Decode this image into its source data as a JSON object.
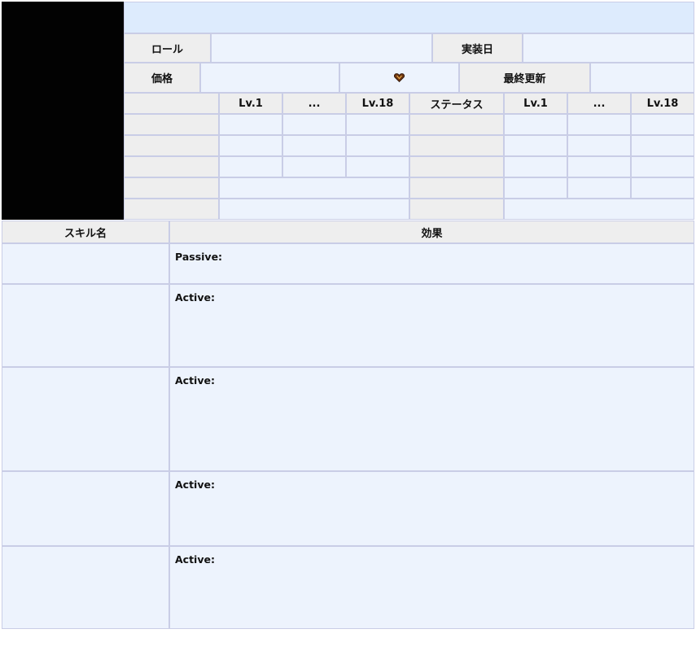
{
  "info": {
    "role_label": "ロール",
    "release_label": "実装日",
    "price_label": "価格",
    "updated_label": "最終更新",
    "currency_icon": "heart-gem-icon"
  },
  "stats": {
    "headers": [
      "Lv.1",
      "...",
      "Lv.18",
      "ステータス",
      "Lv.1",
      "...",
      "Lv.18"
    ]
  },
  "skills": {
    "name_header": "スキル名",
    "effect_header": "効果",
    "rows": [
      {
        "type": "Passive:"
      },
      {
        "type": "Active:"
      },
      {
        "type": "Active:"
      },
      {
        "type": "Active:"
      },
      {
        "type": "Active:"
      }
    ]
  },
  "colors": {
    "header_bg": "#eeeeee",
    "cell_bg": "#edf3fd",
    "top_bar": "#ddebfd",
    "border": "#c9cde6",
    "portrait": "#020202"
  }
}
